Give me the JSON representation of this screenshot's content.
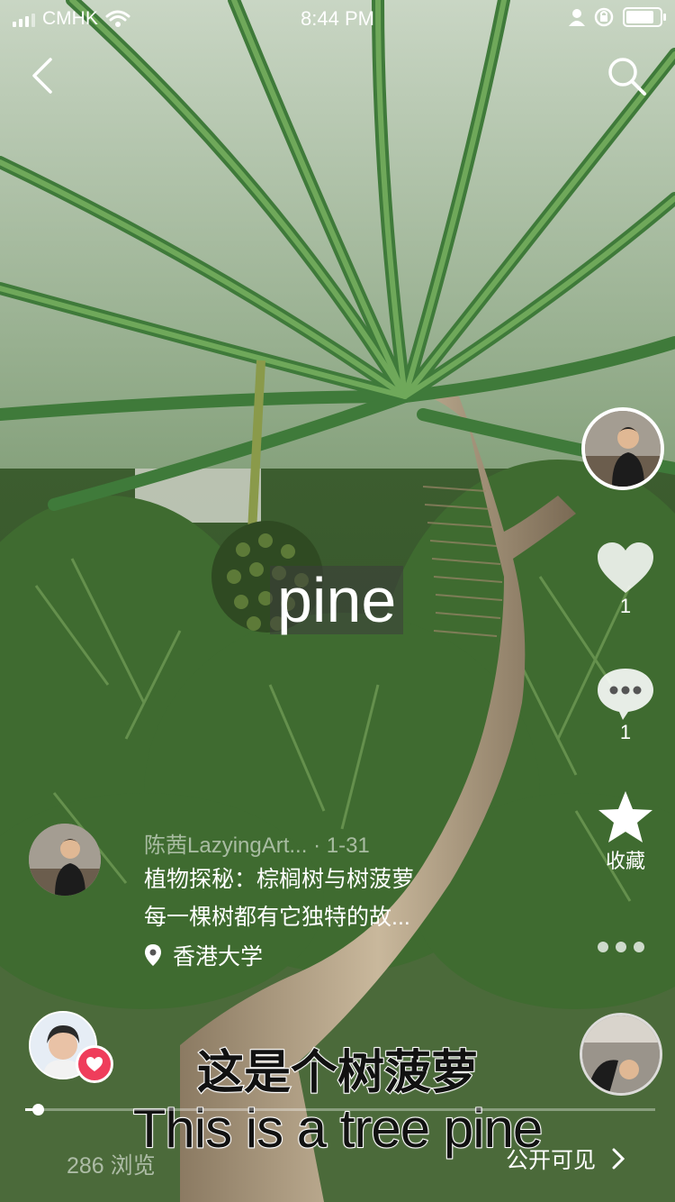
{
  "status_bar": {
    "carrier": "CMHK",
    "time": "8:44 PM"
  },
  "video_caption": "pine",
  "actions": {
    "like_count": "1",
    "comment_count": "1",
    "favorite_label": "收藏"
  },
  "post": {
    "author": "陈茜LazyingArt...",
    "date": "· 1-31",
    "title": "植物探秘：棕榈树与树菠萝",
    "description": "每一棵树都有它独特的故...",
    "location": "香港大学"
  },
  "subtitles": {
    "chinese": "这是个树菠萝",
    "english": "This is a tree pine"
  },
  "footer": {
    "views": "286 浏览",
    "visibility": "公开可见"
  },
  "playback": {
    "progress": 0.02
  },
  "colors": {
    "accent_heart": "#ef3d5b",
    "text": "#ffffff"
  }
}
